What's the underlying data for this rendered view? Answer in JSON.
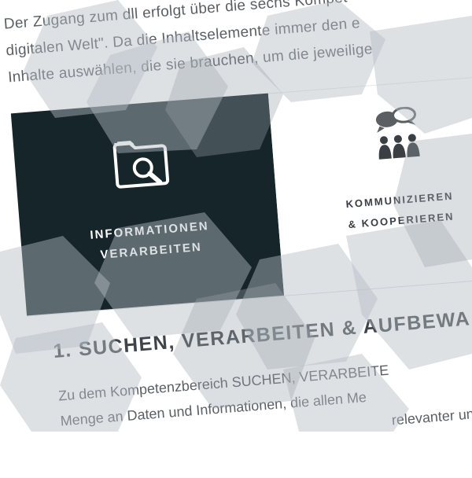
{
  "intro": {
    "line1": "Der Zugang zum dll erfolgt über die sechs Kompet",
    "line2": "digitalen Welt\". Da die Inhaltselemente immer den e",
    "line3": "Inhalte auswählen, die sie brauchen, um die jeweilige"
  },
  "tiles": [
    {
      "line1": "INFORMATIONEN",
      "line2": "VERARBEITEN",
      "icon": "folder-search-icon",
      "active": true
    },
    {
      "line1": "KOMMUNIZIEREN",
      "line2": "& KOOPERIEREN",
      "icon": "people-chat-icon",
      "active": false
    }
  ],
  "section": {
    "heading": "1. SUCHEN, VERARBEITEN & AUFBEWA",
    "body_line1": "Zu dem Kompetenzbereich SUCHEN, VERARBEITE",
    "body_line2": "Menge an Daten und Informationen, die allen Me",
    "body_line3": "relevanter und ve"
  },
  "colors": {
    "dark_tile": "#15252a",
    "text": "#4a4f54",
    "hex_overlay": "#b4bcc4"
  }
}
